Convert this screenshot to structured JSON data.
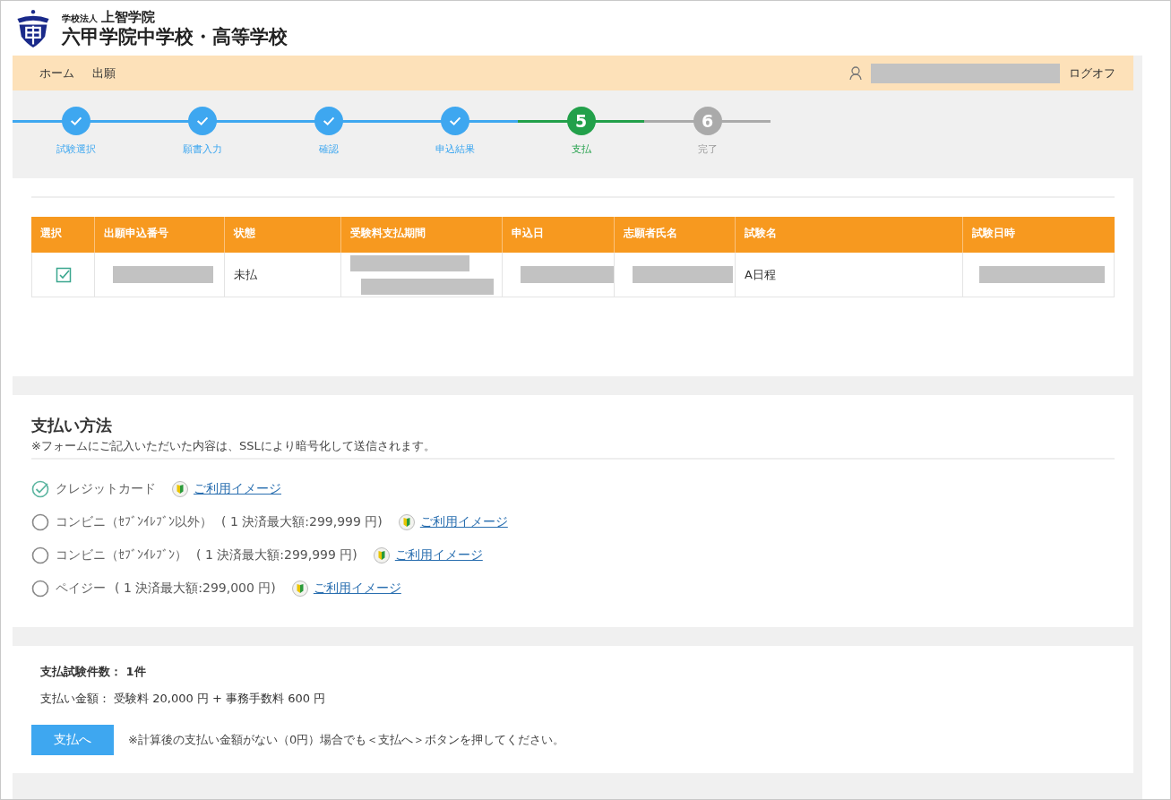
{
  "header": {
    "corp": "学校法人",
    "corp_name": "上智学院",
    "school": "六甲学院中学校・高等学校"
  },
  "nav": {
    "items": [
      "ホーム",
      "出願"
    ],
    "logoff": "ログオフ"
  },
  "steps": [
    {
      "label": "試験選択",
      "completed": true,
      "selected": false
    },
    {
      "label": "願書入力",
      "completed": true,
      "selected": false
    },
    {
      "label": "確認",
      "completed": true,
      "selected": false
    },
    {
      "label": "申込結果",
      "completed": true,
      "selected": false
    },
    {
      "label": "支払",
      "completed": false,
      "selected": true,
      "number": "5"
    },
    {
      "label": "完了",
      "completed": false,
      "selected": false,
      "number": "6"
    }
  ],
  "table": {
    "columns": [
      "選択",
      "出願申込番号",
      "状態",
      "受験料支払期間",
      "申込日",
      "志願者氏名",
      "試験名",
      "試験日時"
    ],
    "rows": [
      {
        "cells": [
          {
            "kind": "check",
            "checked": true
          },
          {
            "kind": "redacted"
          },
          {
            "kind": "text",
            "text": "未払"
          },
          {
            "kind": "redacted_double"
          },
          {
            "kind": "redacted"
          },
          {
            "kind": "redacted"
          },
          {
            "kind": "text",
            "text": "A日程"
          },
          {
            "kind": "redacted_wide"
          }
        ]
      }
    ]
  },
  "payment": {
    "title": "支払い方法",
    "note": "※フォームにご記入いただいた内容は、SSLにより暗号化して送信されます。",
    "methods": [
      {
        "label": "クレジットカード",
        "selected": true,
        "link": "ご利用イメージ"
      },
      {
        "label": "コンビニ（ｾﾌﾞﾝｲﾚﾌﾞﾝ以外）",
        "limit": "( 1 決済最大額:299,999 円)",
        "selected": false,
        "link": "ご利用イメージ"
      },
      {
        "label": "コンビニ（ｾﾌﾞﾝｲﾚﾌﾞﾝ）",
        "limit": "( 1 決済最大額:299,999 円)",
        "selected": false,
        "link": "ご利用イメージ"
      },
      {
        "label": "ペイジー",
        "limit": "( 1 決済最大額:299,000 円)",
        "selected": false,
        "link": "ご利用イメージ"
      }
    ]
  },
  "summary": {
    "count": "支払試験件数： 1件",
    "amount": "支払い金額： 受験料 20,000 円 + 事務手数料 600 円",
    "button": "支払へ",
    "note": "※計算後の支払い金額がない（0円）場合でも＜支払へ＞ボタンを押してください。"
  }
}
